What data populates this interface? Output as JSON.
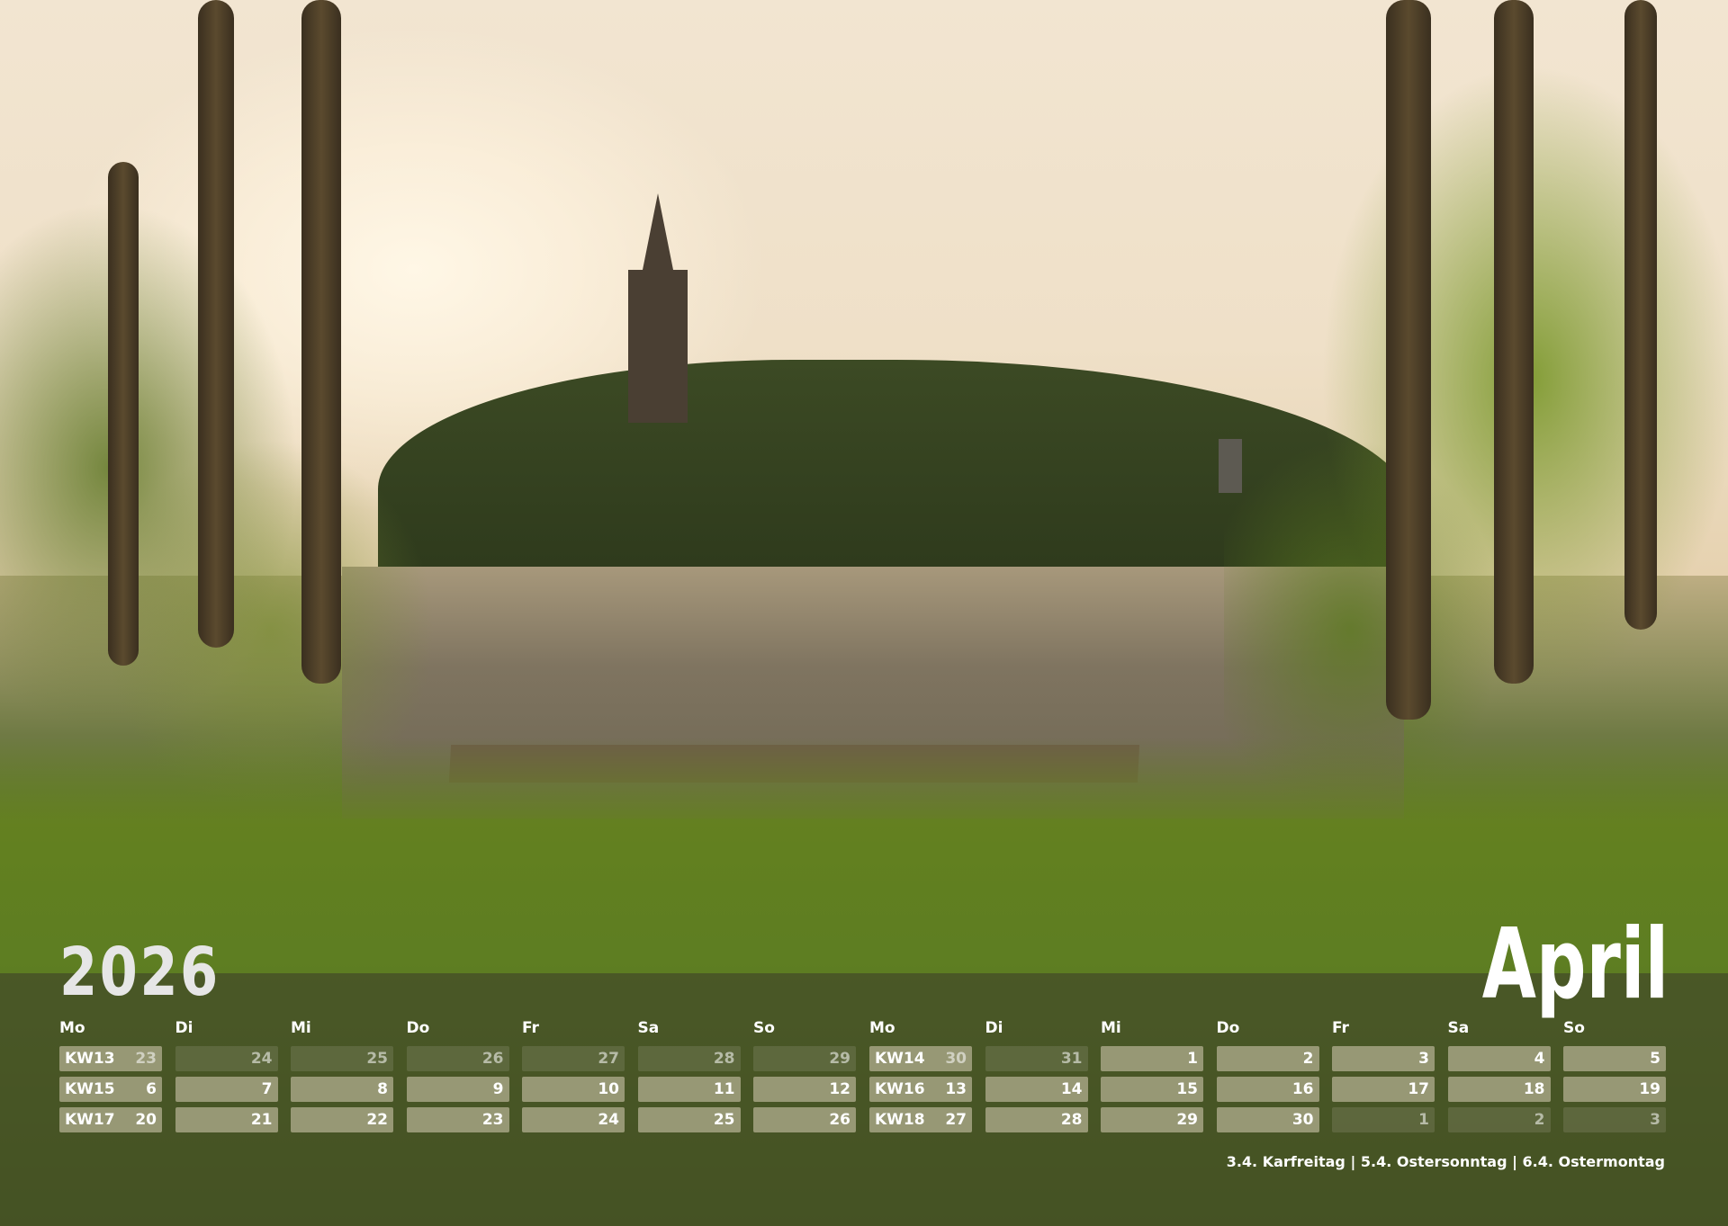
{
  "year": "2026",
  "month": "April",
  "weekday_headers": [
    "Mo",
    "Di",
    "Mi",
    "Do",
    "Fr",
    "Sa",
    "So"
  ],
  "left_weeks": [
    {
      "kw": "KW13",
      "days": [
        {
          "d": "23",
          "cur": false
        },
        {
          "d": "24",
          "cur": false
        },
        {
          "d": "25",
          "cur": false
        },
        {
          "d": "26",
          "cur": false
        },
        {
          "d": "27",
          "cur": false
        },
        {
          "d": "28",
          "cur": false
        },
        {
          "d": "29",
          "cur": false
        }
      ]
    },
    {
      "kw": "KW15",
      "days": [
        {
          "d": "6",
          "cur": true
        },
        {
          "d": "7",
          "cur": true
        },
        {
          "d": "8",
          "cur": true
        },
        {
          "d": "9",
          "cur": true
        },
        {
          "d": "10",
          "cur": true
        },
        {
          "d": "11",
          "cur": true
        },
        {
          "d": "12",
          "cur": true
        }
      ]
    },
    {
      "kw": "KW17",
      "days": [
        {
          "d": "20",
          "cur": true
        },
        {
          "d": "21",
          "cur": true
        },
        {
          "d": "22",
          "cur": true
        },
        {
          "d": "23",
          "cur": true
        },
        {
          "d": "24",
          "cur": true
        },
        {
          "d": "25",
          "cur": true
        },
        {
          "d": "26",
          "cur": true
        }
      ]
    }
  ],
  "right_weeks": [
    {
      "kw": "KW14",
      "days": [
        {
          "d": "30",
          "cur": false
        },
        {
          "d": "31",
          "cur": false
        },
        {
          "d": "1",
          "cur": true
        },
        {
          "d": "2",
          "cur": true
        },
        {
          "d": "3",
          "cur": true
        },
        {
          "d": "4",
          "cur": true
        },
        {
          "d": "5",
          "cur": true
        }
      ]
    },
    {
      "kw": "KW16",
      "days": [
        {
          "d": "13",
          "cur": true
        },
        {
          "d": "14",
          "cur": true
        },
        {
          "d": "15",
          "cur": true
        },
        {
          "d": "16",
          "cur": true
        },
        {
          "d": "17",
          "cur": true
        },
        {
          "d": "18",
          "cur": true
        },
        {
          "d": "19",
          "cur": true
        }
      ]
    },
    {
      "kw": "KW18",
      "days": [
        {
          "d": "27",
          "cur": true
        },
        {
          "d": "28",
          "cur": true
        },
        {
          "d": "29",
          "cur": true
        },
        {
          "d": "30",
          "cur": true
        },
        {
          "d": "1",
          "cur": false
        },
        {
          "d": "2",
          "cur": false
        },
        {
          "d": "3",
          "cur": false
        }
      ]
    }
  ],
  "holidays": "3.4. Karfreitag | 5.4. Ostersonntag | 6.4. Ostermontag"
}
